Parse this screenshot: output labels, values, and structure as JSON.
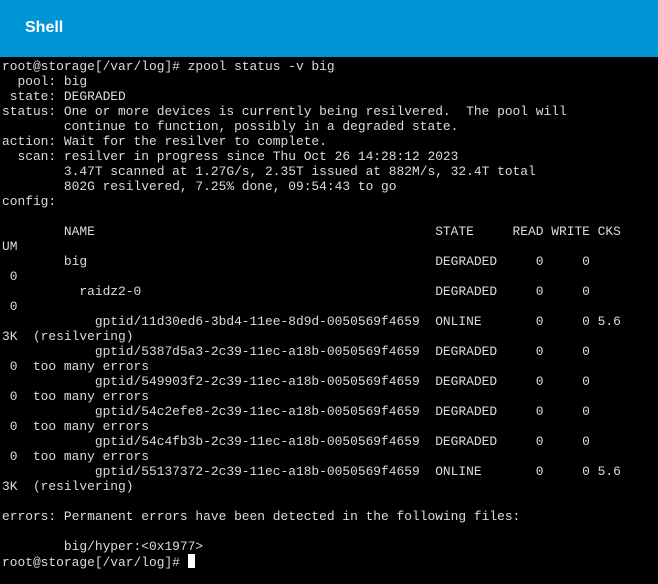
{
  "window": {
    "title": "Shell"
  },
  "terminal": {
    "lines": [
      "root@storage[/var/log]# zpool status -v big",
      "  pool: big",
      " state: DEGRADED",
      "status: One or more devices is currently being resilvered.  The pool will",
      "        continue to function, possibly in a degraded state.",
      "action: Wait for the resilver to complete.",
      "  scan: resilver in progress since Thu Oct 26 14:28:12 2023",
      "        3.47T scanned at 1.27G/s, 2.35T issued at 882M/s, 32.4T total",
      "        802G resilvered, 7.25% done, 09:54:43 to go",
      "config:",
      "",
      "        NAME                                            STATE     READ WRITE CKS",
      "UM",
      "        big                                             DEGRADED     0     0",
      " 0",
      "          raidz2-0                                      DEGRADED     0     0",
      " 0",
      "            gptid/11d30ed6-3bd4-11ee-8d9d-0050569f4659  ONLINE       0     0 5.6",
      "3K  (resilvering)",
      "            gptid/5387d5a3-2c39-11ec-a18b-0050569f4659  DEGRADED     0     0",
      " 0  too many errors",
      "            gptid/549903f2-2c39-11ec-a18b-0050569f4659  DEGRADED     0     0",
      " 0  too many errors",
      "            gptid/54c2efe8-2c39-11ec-a18b-0050569f4659  DEGRADED     0     0",
      " 0  too many errors",
      "            gptid/54c4fb3b-2c39-11ec-a18b-0050569f4659  DEGRADED     0     0",
      " 0  too many errors",
      "            gptid/55137372-2c39-11ec-a18b-0050569f4659  ONLINE       0     0 5.6",
      "3K  (resilvering)",
      "",
      "errors: Permanent errors have been detected in the following files:",
      "",
      "        big/hyper:<0x1977>"
    ],
    "prompt": "root@storage[/var/log]# "
  },
  "colors": {
    "titlebar": "#0095d5",
    "terminal_bg": "#000000",
    "terminal_fg": "#dcdcdc"
  }
}
